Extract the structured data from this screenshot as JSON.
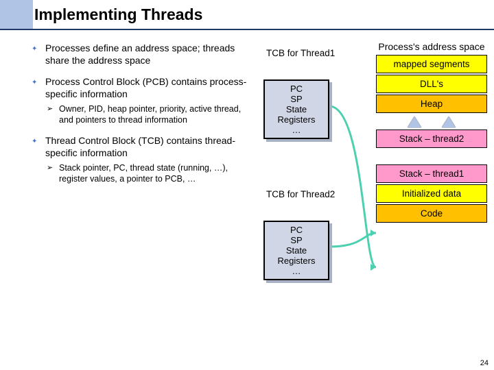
{
  "title": "Implementing Threads",
  "bullets": [
    {
      "text": "Processes define an address space; threads share the address space",
      "sub": []
    },
    {
      "text": "Process Control Block (PCB) contains process-specific information",
      "sub": [
        "Owner, PID, heap pointer, priority, active thread, and pointers to thread information"
      ]
    },
    {
      "text": "Thread Control Block (TCB) contains thread-specific information",
      "sub": [
        "Stack pointer, PC, thread state (running, …), register values, a pointer to PCB, …"
      ]
    }
  ],
  "tcb1": {
    "label": "TCB for Thread1",
    "lines": [
      "PC",
      "SP",
      "State",
      "Registers",
      "…"
    ]
  },
  "tcb2": {
    "label": "TCB for Thread2",
    "lines": [
      "PC",
      "SP",
      "State",
      "Registers",
      "…"
    ]
  },
  "mem": {
    "title": "Process's address space",
    "mapped": "mapped segments",
    "dll": "DLL's",
    "heap": "Heap",
    "stack2": "Stack – thread2",
    "stack1": "Stack – thread1",
    "init": "Initialized data",
    "code": "Code"
  },
  "page": "24",
  "colors": {
    "accent": "#b0c4e6",
    "rule": "#203864",
    "pointer": "#4dd0b0",
    "yellow": "#ffff00",
    "orange": "#ffc000",
    "pink": "#ff99cc",
    "tcb": "#d0d6e6"
  }
}
